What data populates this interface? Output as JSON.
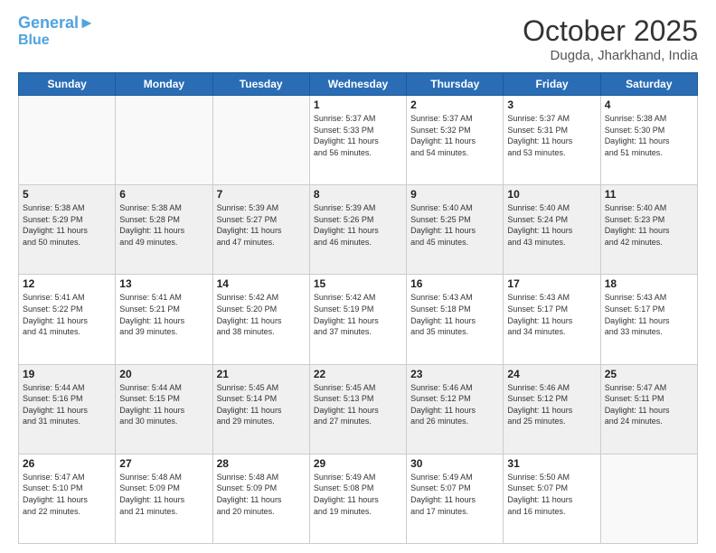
{
  "header": {
    "logo_line1": "General",
    "logo_line2": "Blue",
    "month": "October 2025",
    "location": "Dugda, Jharkhand, India"
  },
  "days_of_week": [
    "Sunday",
    "Monday",
    "Tuesday",
    "Wednesday",
    "Thursday",
    "Friday",
    "Saturday"
  ],
  "weeks": [
    [
      {
        "day": "",
        "info": ""
      },
      {
        "day": "",
        "info": ""
      },
      {
        "day": "",
        "info": ""
      },
      {
        "day": "1",
        "info": "Sunrise: 5:37 AM\nSunset: 5:33 PM\nDaylight: 11 hours\nand 56 minutes."
      },
      {
        "day": "2",
        "info": "Sunrise: 5:37 AM\nSunset: 5:32 PM\nDaylight: 11 hours\nand 54 minutes."
      },
      {
        "day": "3",
        "info": "Sunrise: 5:37 AM\nSunset: 5:31 PM\nDaylight: 11 hours\nand 53 minutes."
      },
      {
        "day": "4",
        "info": "Sunrise: 5:38 AM\nSunset: 5:30 PM\nDaylight: 11 hours\nand 51 minutes."
      }
    ],
    [
      {
        "day": "5",
        "info": "Sunrise: 5:38 AM\nSunset: 5:29 PM\nDaylight: 11 hours\nand 50 minutes."
      },
      {
        "day": "6",
        "info": "Sunrise: 5:38 AM\nSunset: 5:28 PM\nDaylight: 11 hours\nand 49 minutes."
      },
      {
        "day": "7",
        "info": "Sunrise: 5:39 AM\nSunset: 5:27 PM\nDaylight: 11 hours\nand 47 minutes."
      },
      {
        "day": "8",
        "info": "Sunrise: 5:39 AM\nSunset: 5:26 PM\nDaylight: 11 hours\nand 46 minutes."
      },
      {
        "day": "9",
        "info": "Sunrise: 5:40 AM\nSunset: 5:25 PM\nDaylight: 11 hours\nand 45 minutes."
      },
      {
        "day": "10",
        "info": "Sunrise: 5:40 AM\nSunset: 5:24 PM\nDaylight: 11 hours\nand 43 minutes."
      },
      {
        "day": "11",
        "info": "Sunrise: 5:40 AM\nSunset: 5:23 PM\nDaylight: 11 hours\nand 42 minutes."
      }
    ],
    [
      {
        "day": "12",
        "info": "Sunrise: 5:41 AM\nSunset: 5:22 PM\nDaylight: 11 hours\nand 41 minutes."
      },
      {
        "day": "13",
        "info": "Sunrise: 5:41 AM\nSunset: 5:21 PM\nDaylight: 11 hours\nand 39 minutes."
      },
      {
        "day": "14",
        "info": "Sunrise: 5:42 AM\nSunset: 5:20 PM\nDaylight: 11 hours\nand 38 minutes."
      },
      {
        "day": "15",
        "info": "Sunrise: 5:42 AM\nSunset: 5:19 PM\nDaylight: 11 hours\nand 37 minutes."
      },
      {
        "day": "16",
        "info": "Sunrise: 5:43 AM\nSunset: 5:18 PM\nDaylight: 11 hours\nand 35 minutes."
      },
      {
        "day": "17",
        "info": "Sunrise: 5:43 AM\nSunset: 5:17 PM\nDaylight: 11 hours\nand 34 minutes."
      },
      {
        "day": "18",
        "info": "Sunrise: 5:43 AM\nSunset: 5:17 PM\nDaylight: 11 hours\nand 33 minutes."
      }
    ],
    [
      {
        "day": "19",
        "info": "Sunrise: 5:44 AM\nSunset: 5:16 PM\nDaylight: 11 hours\nand 31 minutes."
      },
      {
        "day": "20",
        "info": "Sunrise: 5:44 AM\nSunset: 5:15 PM\nDaylight: 11 hours\nand 30 minutes."
      },
      {
        "day": "21",
        "info": "Sunrise: 5:45 AM\nSunset: 5:14 PM\nDaylight: 11 hours\nand 29 minutes."
      },
      {
        "day": "22",
        "info": "Sunrise: 5:45 AM\nSunset: 5:13 PM\nDaylight: 11 hours\nand 27 minutes."
      },
      {
        "day": "23",
        "info": "Sunrise: 5:46 AM\nSunset: 5:12 PM\nDaylight: 11 hours\nand 26 minutes."
      },
      {
        "day": "24",
        "info": "Sunrise: 5:46 AM\nSunset: 5:12 PM\nDaylight: 11 hours\nand 25 minutes."
      },
      {
        "day": "25",
        "info": "Sunrise: 5:47 AM\nSunset: 5:11 PM\nDaylight: 11 hours\nand 24 minutes."
      }
    ],
    [
      {
        "day": "26",
        "info": "Sunrise: 5:47 AM\nSunset: 5:10 PM\nDaylight: 11 hours\nand 22 minutes."
      },
      {
        "day": "27",
        "info": "Sunrise: 5:48 AM\nSunset: 5:09 PM\nDaylight: 11 hours\nand 21 minutes."
      },
      {
        "day": "28",
        "info": "Sunrise: 5:48 AM\nSunset: 5:09 PM\nDaylight: 11 hours\nand 20 minutes."
      },
      {
        "day": "29",
        "info": "Sunrise: 5:49 AM\nSunset: 5:08 PM\nDaylight: 11 hours\nand 19 minutes."
      },
      {
        "day": "30",
        "info": "Sunrise: 5:49 AM\nSunset: 5:07 PM\nDaylight: 11 hours\nand 17 minutes."
      },
      {
        "day": "31",
        "info": "Sunrise: 5:50 AM\nSunset: 5:07 PM\nDaylight: 11 hours\nand 16 minutes."
      },
      {
        "day": "",
        "info": ""
      }
    ]
  ]
}
